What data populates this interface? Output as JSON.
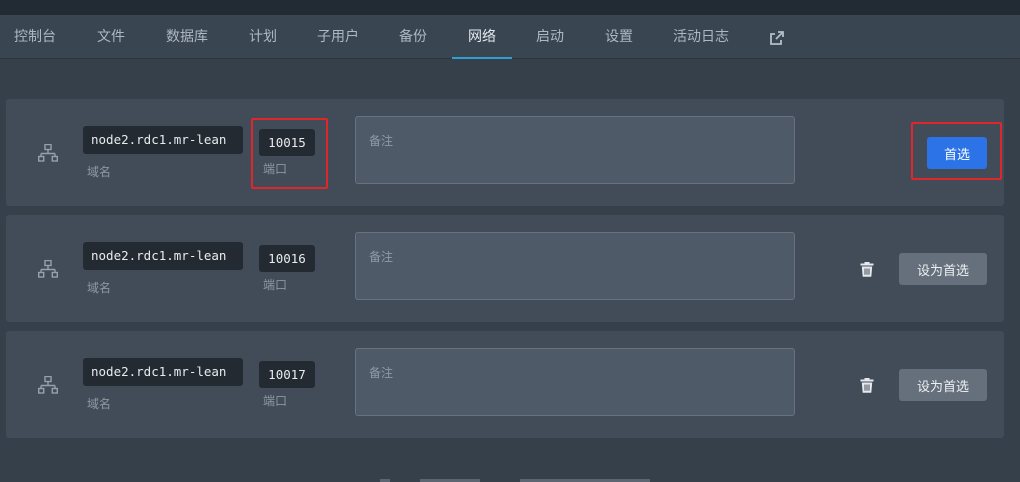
{
  "nav": {
    "tabs": [
      {
        "label": "控制台",
        "name": "tab-console"
      },
      {
        "label": "文件",
        "name": "tab-files"
      },
      {
        "label": "数据库",
        "name": "tab-database"
      },
      {
        "label": "计划",
        "name": "tab-schedule"
      },
      {
        "label": "子用户",
        "name": "tab-subusers"
      },
      {
        "label": "备份",
        "name": "tab-backups"
      },
      {
        "label": "网络",
        "name": "tab-network",
        "active": true
      },
      {
        "label": "启动",
        "name": "tab-startup"
      },
      {
        "label": "设置",
        "name": "tab-settings"
      },
      {
        "label": "活动日志",
        "name": "tab-activity-log"
      }
    ],
    "external_icon": "external-link-icon"
  },
  "allocations": [
    {
      "domain": "node2.rdc1.mr-lean",
      "domain_caption": "域名",
      "port": "10015",
      "port_caption": "端口",
      "note_placeholder": "备注",
      "note_value": "",
      "is_primary": true,
      "button_label": "首选"
    },
    {
      "domain": "node2.rdc1.mr-lean",
      "domain_caption": "域名",
      "port": "10016",
      "port_caption": "端口",
      "note_placeholder": "备注",
      "note_value": "",
      "is_primary": false,
      "button_label": "设为首选"
    },
    {
      "domain": "node2.rdc1.mr-lean",
      "domain_caption": "域名",
      "port": "10017",
      "port_caption": "端口",
      "note_placeholder": "备注",
      "note_value": "",
      "is_primary": false,
      "button_label": "设为首选"
    }
  ],
  "icons": {
    "row_icon": "network-icon",
    "delete_icon": "trash-icon"
  },
  "colors": {
    "primary_button": "#2b73e6",
    "secondary_button": "#66707c",
    "active_tab_underline": "#2f9fd0",
    "highlight": "#e0262a"
  }
}
